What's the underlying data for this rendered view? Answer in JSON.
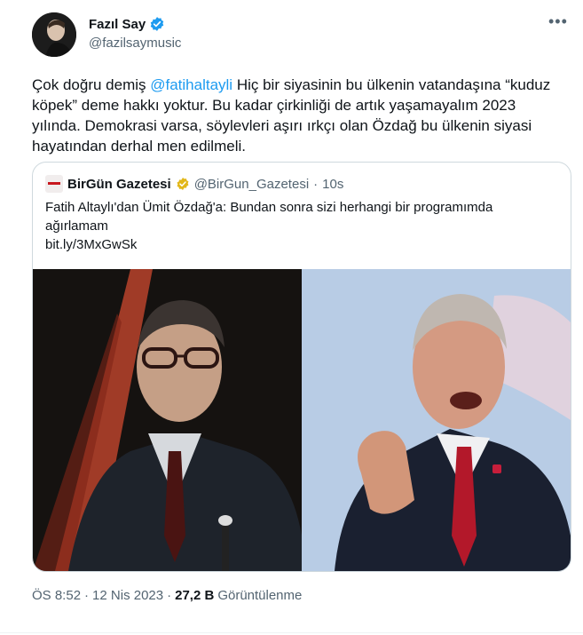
{
  "author": {
    "name": "Fazıl Say",
    "handle": "@fazilsaymusic"
  },
  "more_label": "•••",
  "tweet": {
    "part1": "Çok doğru demiş ",
    "mention": "@fatihaltayli",
    "part2": "  Hiç bir siyasinin bu ülkenin vatandaşına “kuduz köpek” deme hakkı yoktur.  Bu kadar çirkinliği de artık yaşamayalım 2023 yılında. Demokrasi varsa, söylevleri aşırı ırkçı olan Özdağ bu ülkenin siyasi hayatından derhal men edilmeli."
  },
  "quote": {
    "name": "BirGün Gazetesi",
    "handle": "@BirGun_Gazetesi",
    "sep": "·",
    "time": "10s",
    "text": "Fatih Altaylı'dan Ümit Özdağ'a: Bundan sonra sizi herhangi bir programımda ağırlamam",
    "link": "bit.ly/3MxGwSk"
  },
  "footer": {
    "time": "ÖS 8:52",
    "dot": "·",
    "date": "12 Nis 2023",
    "dot2": "·",
    "views": "27,2 B",
    "views_label": "Görüntülenme"
  },
  "colors": {
    "accent": "#1d9bf0",
    "verified_gold": "#e2b719",
    "secondary": "#536471"
  },
  "icons": {
    "verified": "verified-badge-icon",
    "gold_verified": "gold-verified-badge-icon"
  }
}
